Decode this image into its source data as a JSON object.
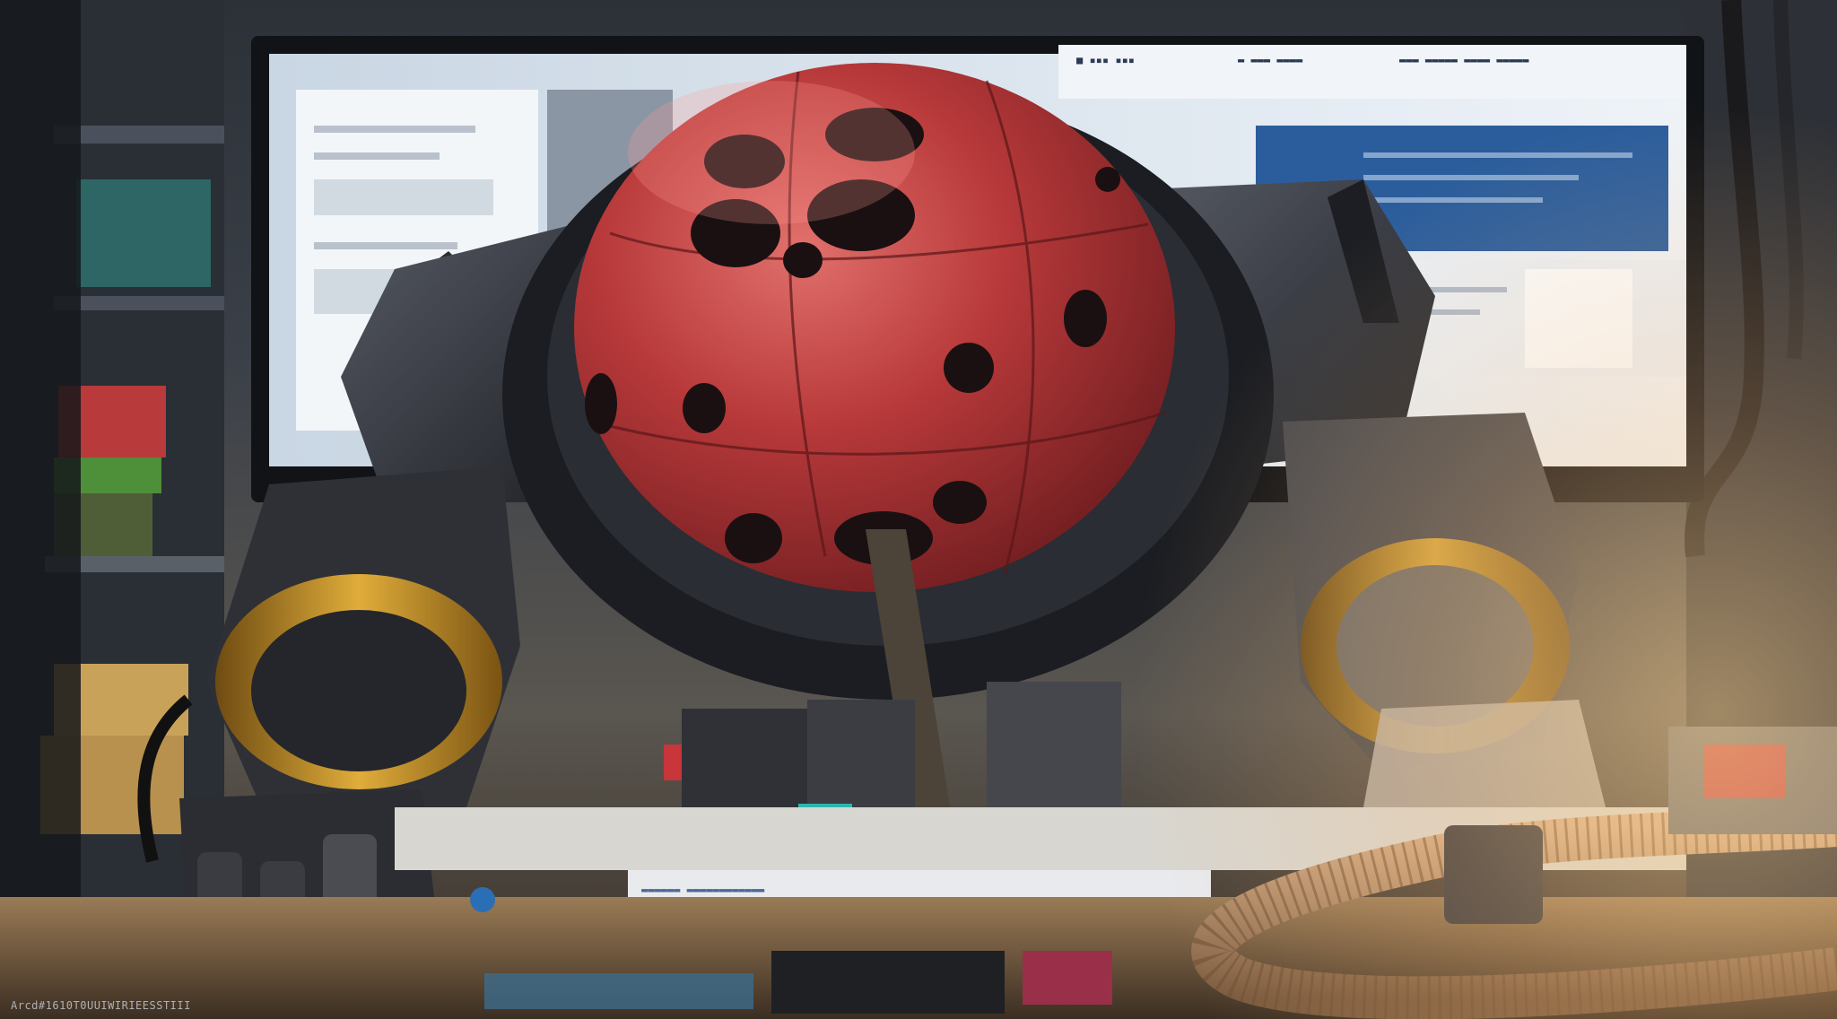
{
  "image": {
    "description_free": true,
    "palette": {
      "sphere": "#b8393a",
      "sphere_dark": "#7e2224",
      "metal": "#3a3d44",
      "metal_dark": "#1f2126",
      "gold_ring": "#c8962a",
      "screen": "#dde6ef",
      "screen_blue": "#2b5d9c",
      "desk": "#8a6c4a",
      "hose": "#b88d66",
      "glow": "#ffd69a"
    }
  },
  "monitor": {
    "header_left": "■ ▪▪▪ ▪▪▪",
    "header_mid": "▬ ▬▬▬ ▬▬▬▬",
    "header_right": "▬▬▬ ▬▬▬▬▬ ▬▬▬▬ ▬▬▬▬▬"
  },
  "desk_label": {
    "text": "▬▬▬▬▬▬ ▬▬▬▬▬▬▬▬▬▬▬▬"
  },
  "caption": {
    "text": "Arcd#1610T0UUIWIRIEESSTIII"
  }
}
